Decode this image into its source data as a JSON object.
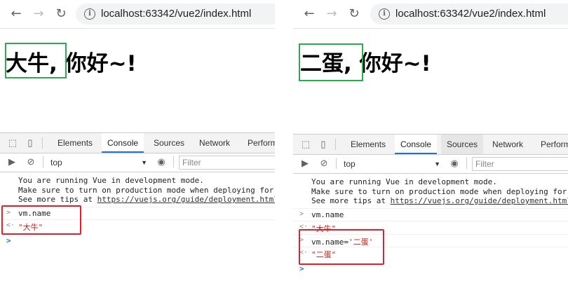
{
  "left": {
    "url": "localhost:63342/vue2/index.html",
    "heading_name": "大牛,",
    "heading_rest": "你好~!",
    "tabs": [
      "Elements",
      "Console",
      "Sources",
      "Network",
      "Perform"
    ],
    "context": "top",
    "filter_placeholder": "Filter",
    "vue_msg": [
      "You are running Vue in development mode.",
      "Make sure to turn on production mode when deploying for",
      "See more tips at "
    ],
    "vue_link": "https://vuejs.org/guide/deployment.html",
    "entries": [
      {
        "caret": ">",
        "text": "vm.name"
      },
      {
        "caret": "<·",
        "text": "\"大牛\""
      }
    ],
    "prompt": ">"
  },
  "right": {
    "url": "localhost:63342/vue2/index.html",
    "heading_name": "二蛋,",
    "heading_rest": "你好~!",
    "tabs": [
      "Elements",
      "Console",
      "Sources",
      "Network",
      "Perform"
    ],
    "context": "top",
    "filter_placeholder": "Filter",
    "vue_msg": [
      "You are running Vue in development mode.",
      "Make sure to turn on production mode when deploying for",
      "See more tips at "
    ],
    "vue_link": "https://vuejs.org/guide/deployment.html",
    "entries": [
      {
        "caret": ">",
        "text": "vm.name"
      },
      {
        "caret": "<·",
        "text": "\"大牛\""
      },
      {
        "caret": ">",
        "text_prefix": "vm.name=",
        "text_str": "'二蛋'"
      },
      {
        "caret": "<·",
        "text": "\"二蛋\""
      }
    ],
    "prompt": ">"
  },
  "icons": {
    "back": "arrow-left-icon",
    "forward": "arrow-right-icon",
    "reload": "reload-icon",
    "info": "info-icon",
    "inspect": "inspect-element-icon",
    "device": "device-toolbar-icon",
    "sidebar": "console-sidebar-icon",
    "clear": "clear-console-icon",
    "eye": "live-expression-icon"
  },
  "colors": {
    "highlight_box": "#2fa84f",
    "annotation_box": "#e0202a",
    "active_tab_underline": "#1a73e8",
    "string": "#c41a16"
  }
}
